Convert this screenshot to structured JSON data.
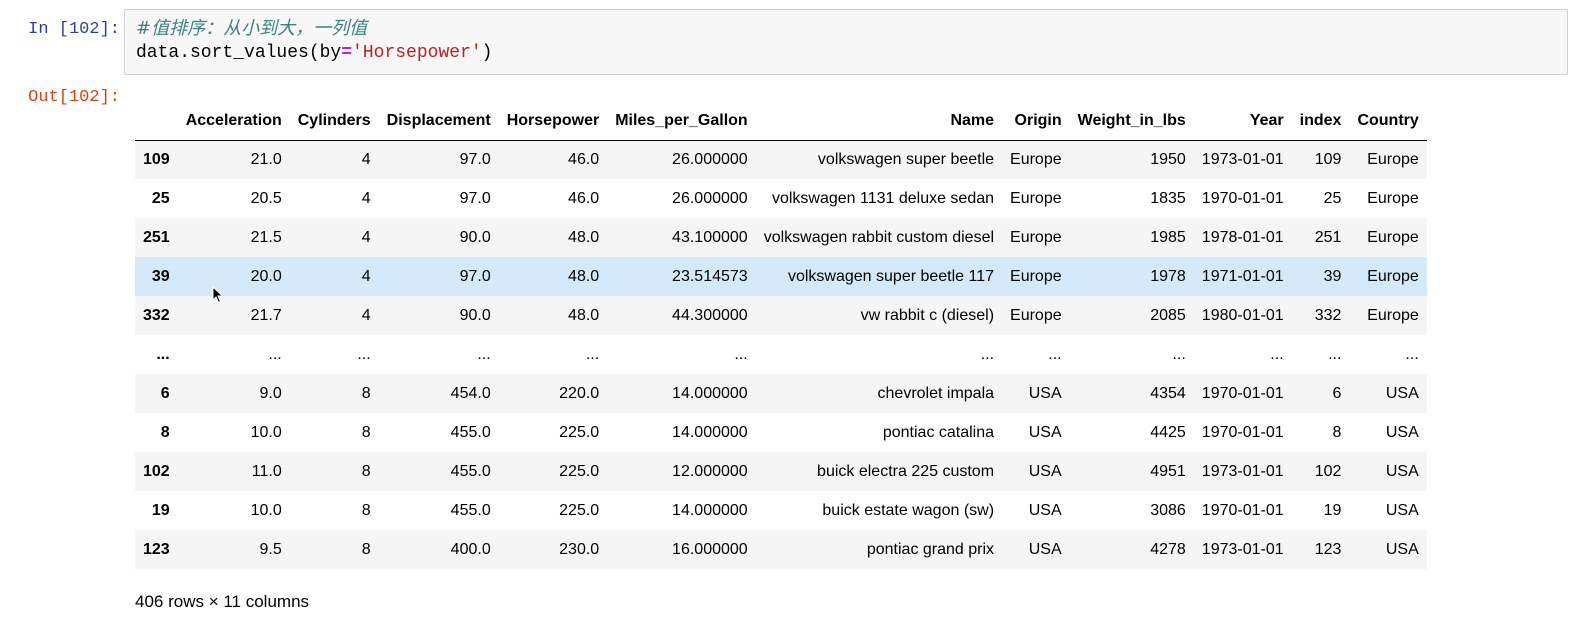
{
  "cell": {
    "in_prompt": "In [102]:",
    "out_prompt": "Out[102]:",
    "code": {
      "comment": "#值排序：从小到大，一列值",
      "line2_prefix": "data.sort_values(by",
      "line2_op": "=",
      "line2_str": "'Horsepower'",
      "line2_suffix": ")"
    }
  },
  "table": {
    "index_header": "",
    "columns": [
      "Acceleration",
      "Cylinders",
      "Displacement",
      "Horsepower",
      "Miles_per_Gallon",
      "Name",
      "Origin",
      "Weight_in_lbs",
      "Year",
      "index",
      "Country"
    ],
    "rows": [
      {
        "idx": "109",
        "cells": [
          "21.0",
          "4",
          "97.0",
          "46.0",
          "26.000000",
          "volkswagen super beetle",
          "Europe",
          "1950",
          "1973-01-01",
          "109",
          "Europe"
        ]
      },
      {
        "idx": "25",
        "cells": [
          "20.5",
          "4",
          "97.0",
          "46.0",
          "26.000000",
          "volkswagen 1131 deluxe sedan",
          "Europe",
          "1835",
          "1970-01-01",
          "25",
          "Europe"
        ]
      },
      {
        "idx": "251",
        "cells": [
          "21.5",
          "4",
          "90.0",
          "48.0",
          "43.100000",
          "volkswagen rabbit custom diesel",
          "Europe",
          "1985",
          "1978-01-01",
          "251",
          "Europe"
        ]
      },
      {
        "idx": "39",
        "cells": [
          "20.0",
          "4",
          "97.0",
          "48.0",
          "23.514573",
          "volkswagen super beetle 117",
          "Europe",
          "1978",
          "1971-01-01",
          "39",
          "Europe"
        ]
      },
      {
        "idx": "332",
        "cells": [
          "21.7",
          "4",
          "90.0",
          "48.0",
          "44.300000",
          "vw rabbit c (diesel)",
          "Europe",
          "2085",
          "1980-01-01",
          "332",
          "Europe"
        ]
      },
      {
        "idx": "...",
        "cells": [
          "...",
          "...",
          "...",
          "...",
          "...",
          "...",
          "...",
          "...",
          "...",
          "...",
          "..."
        ]
      },
      {
        "idx": "6",
        "cells": [
          "9.0",
          "8",
          "454.0",
          "220.0",
          "14.000000",
          "chevrolet impala",
          "USA",
          "4354",
          "1970-01-01",
          "6",
          "USA"
        ]
      },
      {
        "idx": "8",
        "cells": [
          "10.0",
          "8",
          "455.0",
          "225.0",
          "14.000000",
          "pontiac catalina",
          "USA",
          "4425",
          "1970-01-01",
          "8",
          "USA"
        ]
      },
      {
        "idx": "102",
        "cells": [
          "11.0",
          "8",
          "455.0",
          "225.0",
          "12.000000",
          "buick electra 225 custom",
          "USA",
          "4951",
          "1973-01-01",
          "102",
          "USA"
        ]
      },
      {
        "idx": "19",
        "cells": [
          "10.0",
          "8",
          "455.0",
          "225.0",
          "14.000000",
          "buick estate wagon (sw)",
          "USA",
          "3086",
          "1970-01-01",
          "19",
          "USA"
        ]
      },
      {
        "idx": "123",
        "cells": [
          "9.5",
          "8",
          "400.0",
          "230.0",
          "16.000000",
          "pontiac grand prix",
          "USA",
          "4278",
          "1973-01-01",
          "123",
          "USA"
        ]
      }
    ],
    "hover_row": 3,
    "shape": "406 rows × 11 columns"
  },
  "colors": {
    "in_prompt": "#303F9F",
    "out_prompt": "#D84315",
    "row_hover": "#d4eafa",
    "row_stripe": "#f5f5f5"
  },
  "icons": {
    "cursor": "mouse-pointer-icon"
  }
}
